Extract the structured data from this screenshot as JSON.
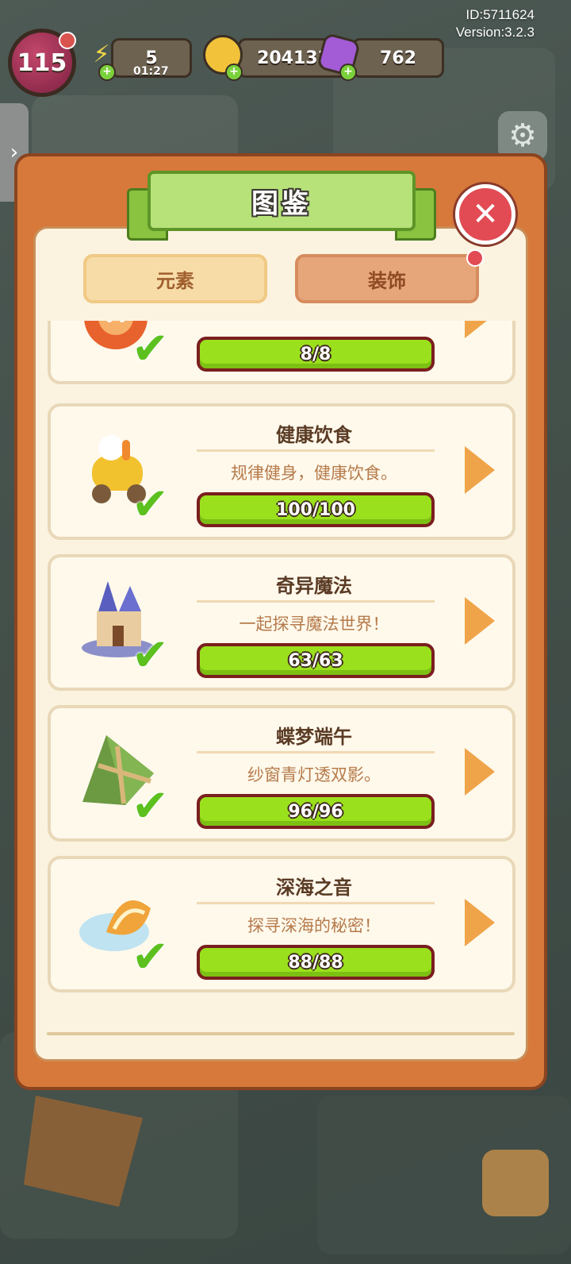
{
  "hud": {
    "level": "115",
    "energy": "5",
    "energy_timer": "01:27",
    "coins": "204133",
    "gems": "762",
    "player_id": "ID:5711624",
    "version": "Version:3.2.3"
  },
  "modal": {
    "title": "图鉴",
    "tabs": [
      {
        "label": "元素"
      },
      {
        "label": "装饰"
      }
    ],
    "items": [
      {
        "title": "",
        "desc": "",
        "progress": "8/8",
        "icon": "rabbit-lantern-icon"
      },
      {
        "title": "健康饮食",
        "desc": "规律健身，健康饮食。",
        "progress": "100/100",
        "icon": "scooter-icon"
      },
      {
        "title": "奇异魔法",
        "desc": "一起探寻魔法世界！",
        "progress": "63/63",
        "icon": "magic-castle-icon"
      },
      {
        "title": "蝶梦端午",
        "desc": "纱窗青灯透双影。",
        "progress": "96/96",
        "icon": "zongzi-icon"
      },
      {
        "title": "深海之音",
        "desc": "探寻深海的秘密！",
        "progress": "88/88",
        "icon": "seashell-icon"
      }
    ]
  },
  "colors": {
    "modal_frame": "#d6793b",
    "progress_fill": "#9be01d",
    "check_green": "#5cc01f",
    "close_red": "#e24b54"
  }
}
